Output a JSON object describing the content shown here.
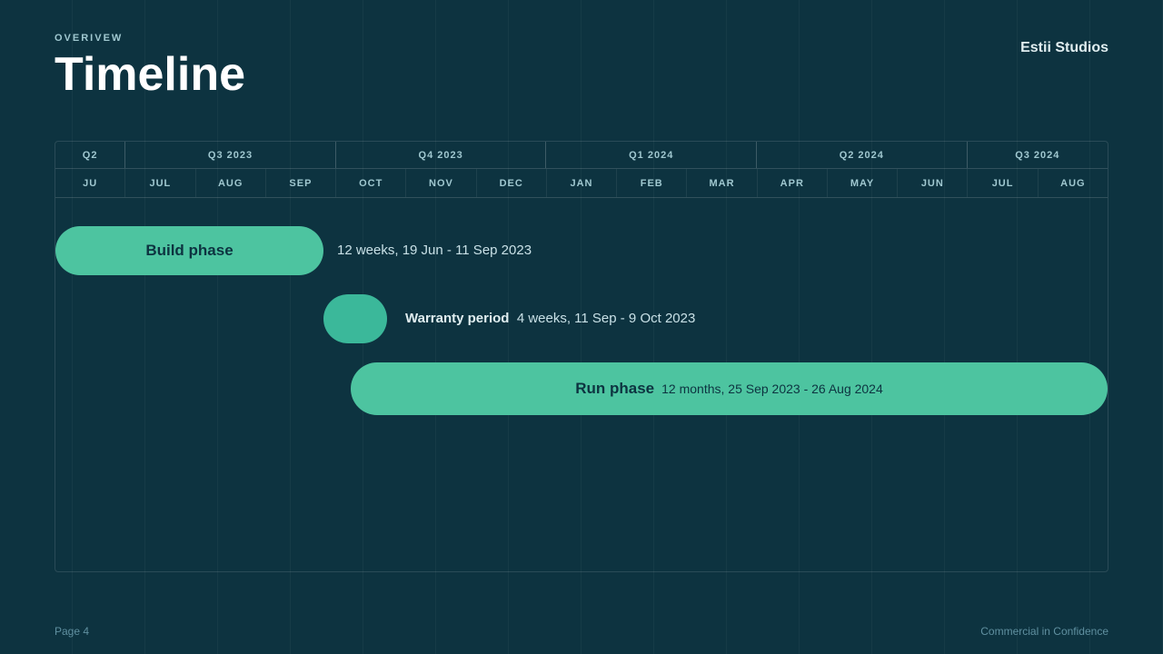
{
  "header": {
    "overline": "OVERIVEW",
    "title": "Timeline",
    "brand": "Estii Studios"
  },
  "footer": {
    "page": "Page 4",
    "confidentiality": "Commercial in Confidence"
  },
  "quarters": [
    {
      "label": "Q2",
      "span": 1
    },
    {
      "label": "Q3 2023",
      "span": 3
    },
    {
      "label": "Q4 2023",
      "span": 3
    },
    {
      "label": "Q1 2024",
      "span": 3
    },
    {
      "label": "Q2 2024",
      "span": 3
    },
    {
      "label": "Q3 2024",
      "span": 2
    }
  ],
  "months": [
    "JU",
    "JUL",
    "AUG",
    "SEP",
    "OCT",
    "NOV",
    "DEC",
    "JAN",
    "FEB",
    "MAR",
    "APR",
    "MAY",
    "JUN",
    "JUL",
    "AUG"
  ],
  "phases": {
    "build": {
      "label": "Build phase",
      "description": "12 weeks, 19 Jun - 11 Sep 2023"
    },
    "warranty": {
      "label": "Warranty period",
      "description": "4 weeks, 11 Sep - 9 Oct 2023"
    },
    "run": {
      "label": "Run phase",
      "description": "12 months, 25 Sep 2023 - 26 Aug 2024"
    }
  }
}
